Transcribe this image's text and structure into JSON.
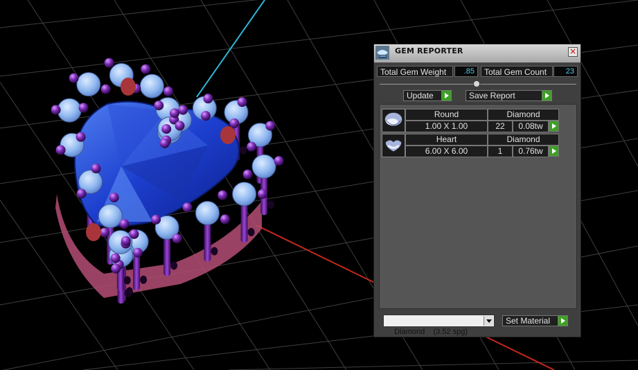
{
  "panel": {
    "title": "GEM REPORTER",
    "close_glyph": "×",
    "title_icon": "gem-reporter-icon",
    "total_weight_label": "Total Gem Weight",
    "total_weight_value": ".85",
    "total_count_label": "Total Gem Count",
    "total_count_value": "23",
    "update_label": "Update",
    "save_report_label": "Save Report",
    "rows": [
      {
        "shape": "Round",
        "material": "Diamond",
        "size": "1.00 X 1.00",
        "count": "22",
        "weight": "0.08tw",
        "icon": "round-gem-icon"
      },
      {
        "shape": "Heart",
        "material": "Diamond",
        "size": "6.00 X 6.00",
        "count": "1",
        "weight": "0.76tw",
        "icon": "heart-gem-icon"
      }
    ],
    "material_select_value": "Diamond    (3.52 spg)",
    "set_material_label": "Set Material"
  },
  "colors": {
    "panel_bg": "#3f3f3f",
    "accent_green": "#3f9f27",
    "value_cyan": "#56c8e8",
    "grid_line": "#5a5a5a",
    "axis_cyan": "#2fb6d6",
    "axis_red": "#c4281c",
    "gem_blue": "#1f3fd8",
    "prong_purple": "#7a2bb5"
  }
}
